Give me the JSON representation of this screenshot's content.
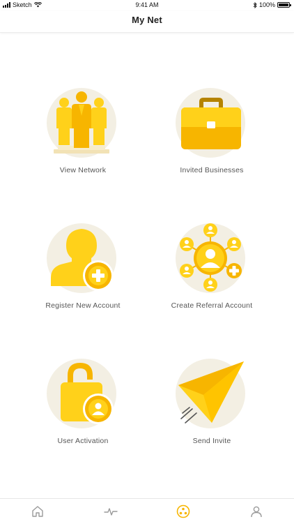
{
  "status_bar": {
    "carrier": "Sketch",
    "time": "9:41 AM",
    "battery": "100%"
  },
  "nav": {
    "title": "My Net"
  },
  "tiles": [
    {
      "label": "View Network",
      "icon": "people-group-icon"
    },
    {
      "label": "Invited Businesses",
      "icon": "briefcase-icon"
    },
    {
      "label": "Register New Account",
      "icon": "add-user-icon"
    },
    {
      "label": "Create Referral Account",
      "icon": "referral-network-icon"
    },
    {
      "label": "User Activation",
      "icon": "unlocked-padlock-icon"
    },
    {
      "label": "Send Invite",
      "icon": "paper-plane-icon"
    }
  ],
  "tab_bar": {
    "items": [
      {
        "name": "home",
        "icon": "home-icon",
        "active": false
      },
      {
        "name": "activity",
        "icon": "activity-icon",
        "active": false
      },
      {
        "name": "network",
        "icon": "network-icon",
        "active": true
      },
      {
        "name": "profile",
        "icon": "profile-icon",
        "active": false
      }
    ]
  },
  "colors": {
    "accent": "#f7b500",
    "accent_light": "#ffd11a",
    "circle_bg": "#f3efe3",
    "inactive_tab": "#9a9a9a"
  }
}
